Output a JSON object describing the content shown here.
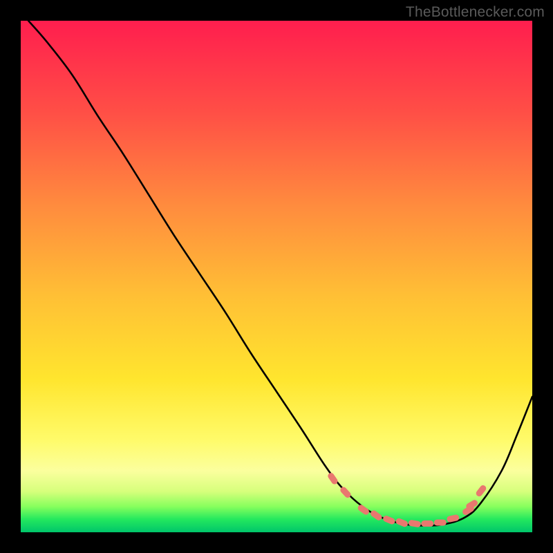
{
  "credit": "TheBottlenecker.com",
  "colors": {
    "frame": "#000000",
    "credit_text": "#5a5a5a",
    "curve_stroke": "#000000",
    "marker_fill": "#e9786f",
    "marker_stroke": "#e9786f"
  },
  "chart_data": {
    "type": "line",
    "title": "",
    "xlabel": "",
    "ylabel": "",
    "xlim": [
      0,
      1
    ],
    "ylim": [
      0,
      1
    ],
    "note": "Unlabeled axes. X treated as normalized 0–1 left→right across plot area; Y treated as normalized 0–1 bottom→top (0 = green bottom, 1 = red top). Values estimated from pixels of a 740×740 plot.",
    "series": [
      {
        "name": "curve",
        "x": [
          0.015,
          0.05,
          0.1,
          0.15,
          0.2,
          0.25,
          0.3,
          0.35,
          0.4,
          0.45,
          0.5,
          0.55,
          0.595,
          0.63,
          0.67,
          0.71,
          0.75,
          0.79,
          0.83,
          0.87,
          0.9,
          0.94,
          0.97,
          1.0
        ],
        "y": [
          1.0,
          0.96,
          0.895,
          0.815,
          0.74,
          0.66,
          0.58,
          0.505,
          0.43,
          0.35,
          0.275,
          0.2,
          0.13,
          0.085,
          0.049,
          0.027,
          0.016,
          0.013,
          0.016,
          0.03,
          0.058,
          0.12,
          0.19,
          0.265
        ]
      }
    ],
    "markers": {
      "note": "Salmon short-dash markers clustered near the valley of the curve.",
      "points": [
        {
          "x": 0.61,
          "y": 0.105
        },
        {
          "x": 0.635,
          "y": 0.078
        },
        {
          "x": 0.67,
          "y": 0.044
        },
        {
          "x": 0.695,
          "y": 0.033
        },
        {
          "x": 0.72,
          "y": 0.024
        },
        {
          "x": 0.745,
          "y": 0.019
        },
        {
          "x": 0.77,
          "y": 0.017
        },
        {
          "x": 0.795,
          "y": 0.017
        },
        {
          "x": 0.82,
          "y": 0.019
        },
        {
          "x": 0.845,
          "y": 0.027
        },
        {
          "x": 0.875,
          "y": 0.043
        },
        {
          "x": 0.882,
          "y": 0.054
        },
        {
          "x": 0.9,
          "y": 0.081
        }
      ]
    },
    "background_gradient": {
      "direction": "top_to_bottom",
      "stops": [
        {
          "pos": 0.0,
          "color": "#ff1e4e"
        },
        {
          "pos": 0.18,
          "color": "#ff4f46"
        },
        {
          "pos": 0.36,
          "color": "#ff8b3e"
        },
        {
          "pos": 0.54,
          "color": "#ffc035"
        },
        {
          "pos": 0.7,
          "color": "#ffe52e"
        },
        {
          "pos": 0.82,
          "color": "#fffb6a"
        },
        {
          "pos": 0.88,
          "color": "#fbff9e"
        },
        {
          "pos": 0.92,
          "color": "#d7ff7c"
        },
        {
          "pos": 0.95,
          "color": "#86ff5d"
        },
        {
          "pos": 0.975,
          "color": "#23e85e"
        },
        {
          "pos": 1.0,
          "color": "#00c56a"
        }
      ]
    }
  }
}
